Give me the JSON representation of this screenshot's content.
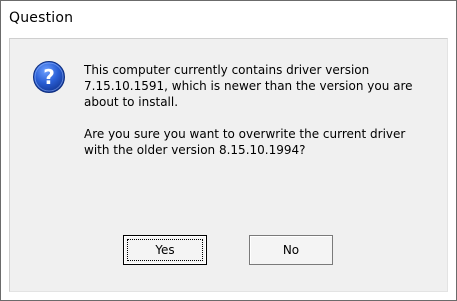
{
  "window": {
    "title": "Question"
  },
  "dialog": {
    "icon": "question-icon",
    "message_line_1": "This computer currently contains driver version 7.15.10.1591, which is newer than the version you are about to install.",
    "message_line_2": "Are you sure you want to overwrite the current driver with the older version 8.15.10.1994?"
  },
  "buttons": {
    "yes_label": "Yes",
    "no_label": "No"
  },
  "colors": {
    "icon_blue": "#1f4fc4",
    "client_bg": "#f0f0f0"
  }
}
